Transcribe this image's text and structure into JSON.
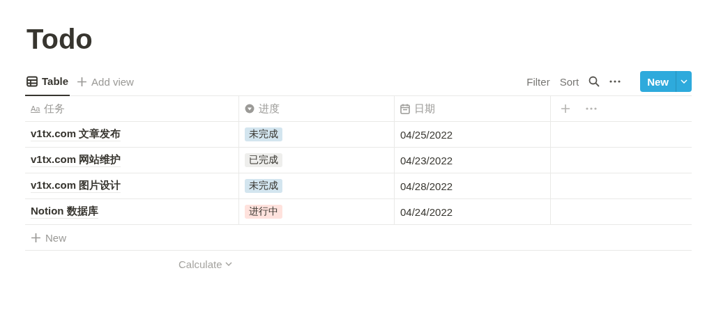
{
  "title": "Todo",
  "views": [
    {
      "label": "Table",
      "selected": true
    }
  ],
  "add_view": "Add view",
  "toolbar": {
    "filter": "Filter",
    "sort": "Sort",
    "new_button": "New"
  },
  "columns": [
    {
      "kind": "title",
      "glyph": "Aa",
      "label": "任务"
    },
    {
      "kind": "select",
      "label": "进度"
    },
    {
      "kind": "date",
      "label": "日期"
    }
  ],
  "rows": [
    {
      "task": "v1tx.com 文章发布",
      "status": {
        "label": "未完成",
        "color": "#d3e5ef"
      },
      "date": "04/25/2022"
    },
    {
      "task": "v1tx.com 网站维护",
      "status": {
        "label": "已完成",
        "color": "#eeeeec"
      },
      "date": "04/23/2022"
    },
    {
      "task": "v1tx.com 图片设计",
      "status": {
        "label": "未完成",
        "color": "#d3e5ef"
      },
      "date": "04/28/2022"
    },
    {
      "task": "Notion 数据库",
      "status": {
        "label": "进行中",
        "color": "#ffe2dd"
      },
      "date": "04/24/2022"
    }
  ],
  "new_row": "New",
  "calculate": "Calculate"
}
